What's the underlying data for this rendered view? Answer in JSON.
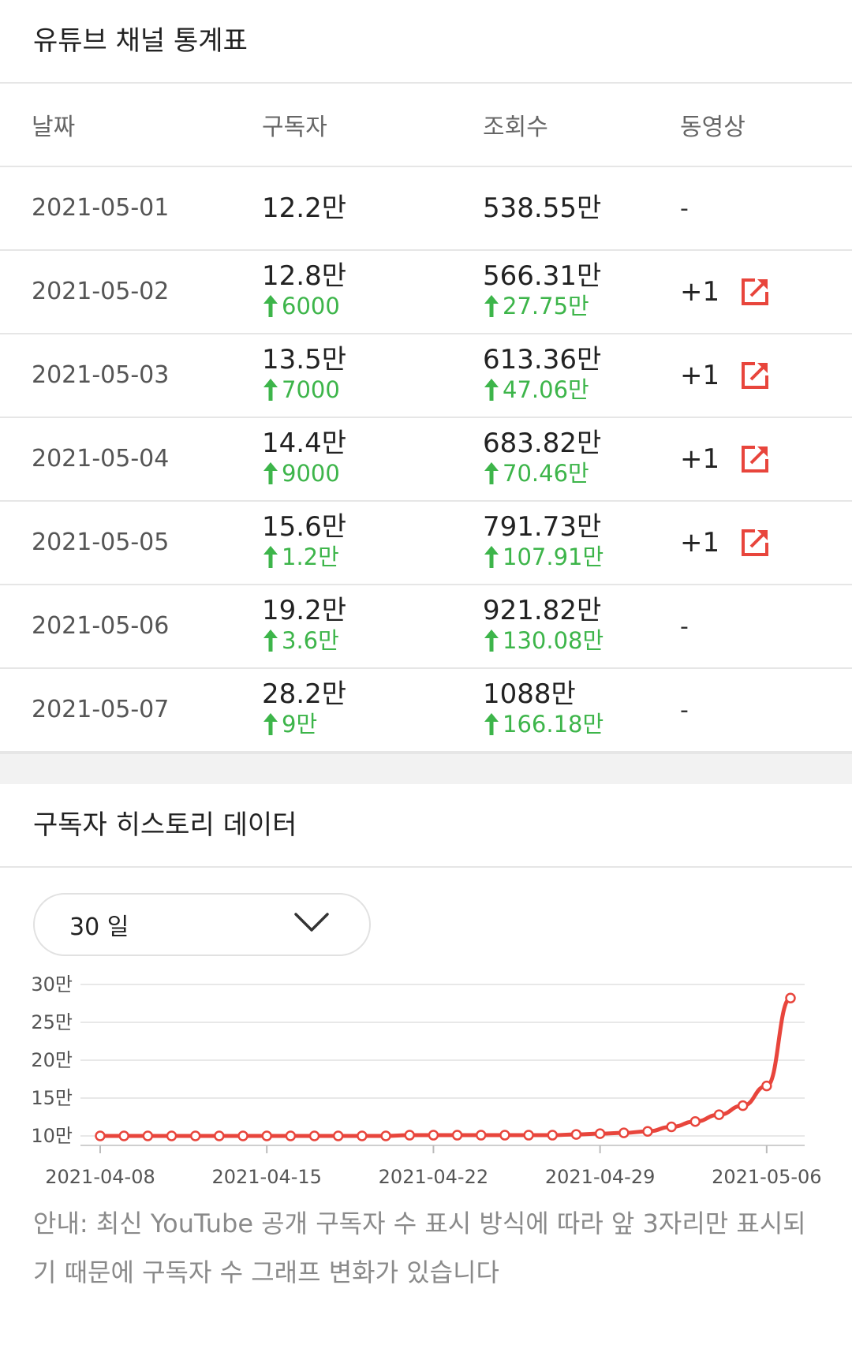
{
  "stats_section": {
    "title": "유튜브 채널 통계표",
    "headers": {
      "date": "날짜",
      "subscribers": "구독자",
      "views": "조회수",
      "videos": "동영상"
    },
    "rows": [
      {
        "date": "2021-05-01",
        "subs": "12.2만",
        "subs_delta": "",
        "views": "538.55만",
        "views_delta": "",
        "videos": "-",
        "has_link": false
      },
      {
        "date": "2021-05-02",
        "subs": "12.8만",
        "subs_delta": "6000",
        "views": "566.31만",
        "views_delta": "27.75만",
        "videos": "+1",
        "has_link": true
      },
      {
        "date": "2021-05-03",
        "subs": "13.5만",
        "subs_delta": "7000",
        "views": "613.36만",
        "views_delta": "47.06만",
        "videos": "+1",
        "has_link": true
      },
      {
        "date": "2021-05-04",
        "subs": "14.4만",
        "subs_delta": "9000",
        "views": "683.82만",
        "views_delta": "70.46만",
        "videos": "+1",
        "has_link": true
      },
      {
        "date": "2021-05-05",
        "subs": "15.6만",
        "subs_delta": "1.2만",
        "views": "791.73만",
        "views_delta": "107.91만",
        "videos": "+1",
        "has_link": true
      },
      {
        "date": "2021-05-06",
        "subs": "19.2만",
        "subs_delta": "3.6만",
        "views": "921.82만",
        "views_delta": "130.08만",
        "videos": "-",
        "has_link": false
      },
      {
        "date": "2021-05-07",
        "subs": "28.2만",
        "subs_delta": "9만",
        "views": "1088만",
        "views_delta": "166.18만",
        "videos": "-",
        "has_link": false
      }
    ]
  },
  "history_section": {
    "title": "구독자 히스토리 데이터",
    "period_select": {
      "value": "30 일"
    },
    "notice": "안내: 최신 YouTube 공개 구독자 수 표시 방식에 따라 앞 3자리만 표시되기 때문에 구독자 수 그래프 변화가 있습니다"
  },
  "colors": {
    "accent_red": "#e8453c",
    "delta_green": "#3db54a",
    "grid": "#e8e8e8"
  },
  "icons": {
    "link": "external-link-icon",
    "up": "arrow-up-icon",
    "dropdown": "chevron-down-icon"
  },
  "chart_data": {
    "type": "line",
    "title": "",
    "xlabel": "",
    "ylabel": "",
    "x_tick_labels": [
      "2021-04-08",
      "2021-04-15",
      "2021-04-22",
      "2021-04-29",
      "2021-05-06"
    ],
    "y_tick_labels": [
      "10만",
      "15만",
      "20만",
      "25만",
      "30만"
    ],
    "y_tick_values": [
      10,
      15,
      20,
      25,
      30
    ],
    "ylim": [
      10,
      30
    ],
    "x_start": "2021-04-08",
    "x_end": "2021-05-07",
    "grid": true,
    "series": [
      {
        "color": "#e8453c",
        "x": [
          "2021-04-08",
          "2021-04-09",
          "2021-04-10",
          "2021-04-11",
          "2021-04-12",
          "2021-04-13",
          "2021-04-14",
          "2021-04-15",
          "2021-04-16",
          "2021-04-17",
          "2021-04-18",
          "2021-04-19",
          "2021-04-20",
          "2021-04-21",
          "2021-04-22",
          "2021-04-23",
          "2021-04-24",
          "2021-04-25",
          "2021-04-26",
          "2021-04-27",
          "2021-04-28",
          "2021-04-29",
          "2021-04-30",
          "2021-05-01",
          "2021-05-02",
          "2021-05-03",
          "2021-05-04",
          "2021-05-05",
          "2021-05-06",
          "2021-05-07"
        ],
        "values": [
          10.0,
          10.0,
          10.0,
          10.0,
          10.0,
          10.0,
          10.0,
          10.0,
          10.0,
          10.0,
          10.0,
          10.0,
          10.0,
          10.1,
          10.1,
          10.1,
          10.1,
          10.1,
          10.1,
          10.1,
          10.2,
          10.3,
          10.4,
          10.6,
          11.2,
          11.9,
          12.8,
          14.0,
          16.6,
          28.2
        ]
      }
    ]
  }
}
